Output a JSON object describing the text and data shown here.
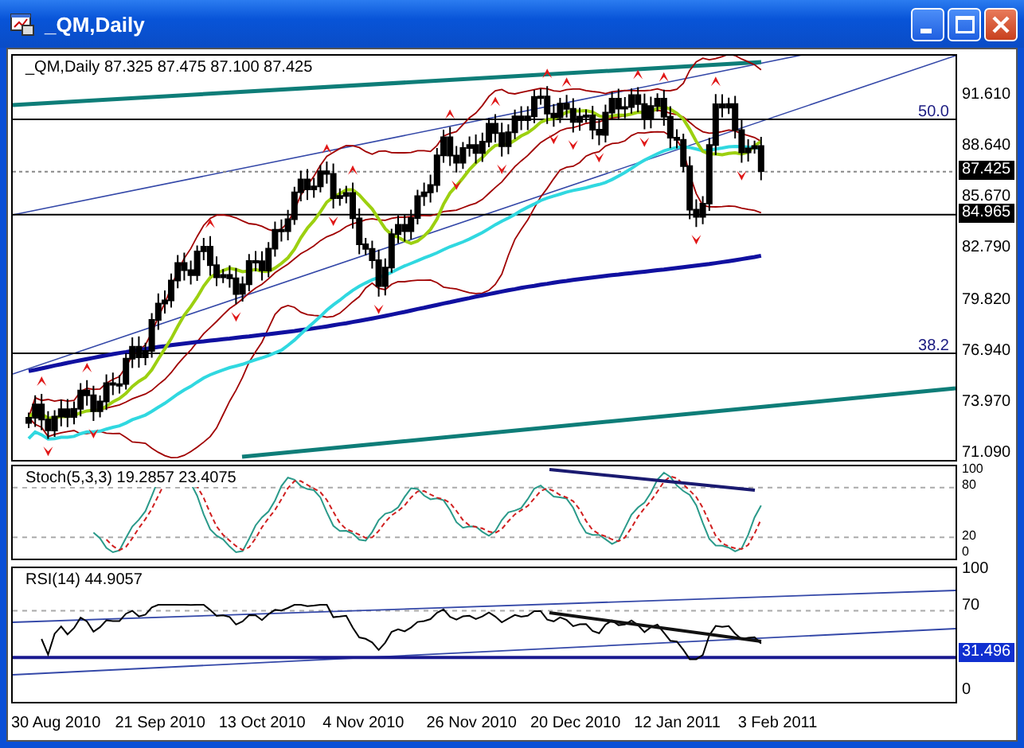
{
  "window": {
    "title": "_QM,Daily"
  },
  "main_chart": {
    "legend": "_QM,Daily  87.325 87.475 87.100 87.425",
    "price_axis": [
      "91.610",
      "88.640",
      "85.670",
      "82.790",
      "79.820",
      "76.940",
      "73.970",
      "71.090"
    ],
    "price_markers": [
      "87.425",
      "84.965"
    ],
    "fib_levels": [
      "50.0",
      "38.2"
    ]
  },
  "stochastic": {
    "legend": "Stoch(5,3,3) 19.2857 23.4075",
    "axis": [
      "100",
      "80",
      "20",
      "0"
    ]
  },
  "rsi": {
    "legend": "RSI(14) 44.9057",
    "axis": [
      "100",
      "70",
      "0"
    ],
    "marker": "31.496"
  },
  "date_axis": [
    "30 Aug 2010",
    "21 Sep 2010",
    "13 Oct 2010",
    "4 Nov 2010",
    "26 Nov 2010",
    "20 Dec 2010",
    "12 Jan 2011",
    "3 Feb 2011"
  ]
}
